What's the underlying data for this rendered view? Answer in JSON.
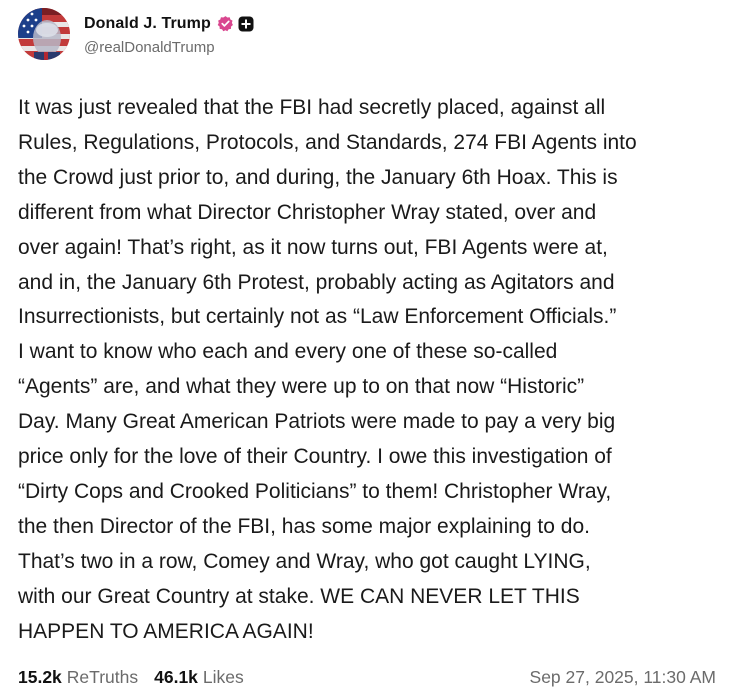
{
  "author": {
    "display_name": "Donald J. Trump",
    "handle": "@realDonaldTrump",
    "verified_icon": "verified-badge-icon",
    "plus_icon": "plus-badge-icon",
    "verified_color": "#d9478f"
  },
  "post": {
    "lines": [
      "It was just revealed that the FBI had secretly placed, against all",
      "Rules, Regulations, Protocols, and Standards, 274 FBI Agents into",
      "the Crowd just prior to, and during, the January 6th Hoax. This is",
      "different from what Director Christopher Wray stated, over and",
      "over again! That’s right, as it now turns out, FBI Agents were at,",
      "and in, the January 6th Protest, probably acting as Agitators and",
      "Insurrectionists, but certainly not as “Law Enforcement Officials.”",
      "I want to know who each and every one of these so-called",
      "“Agents” are, and what they were up to on that now “Historic”",
      "Day. Many Great American Patriots were made to pay a very big",
      "price only for the love of their Country. I owe this investigation of",
      "“Dirty Cops and Crooked Politicians” to them! Christopher Wray,",
      "the then Director of the FBI, has some major explaining to do.",
      "That’s two in a row, Comey and Wray, who got caught LYING,",
      "with our Great Country at stake. WE CAN NEVER LET THIS",
      "HAPPEN TO AMERICA AGAIN!"
    ]
  },
  "stats": {
    "retruths_count": "15.2k",
    "retruths_label": "ReTruths",
    "likes_count": "46.1k",
    "likes_label": "Likes",
    "timestamp": "Sep 27, 2025, 11:30 AM"
  }
}
